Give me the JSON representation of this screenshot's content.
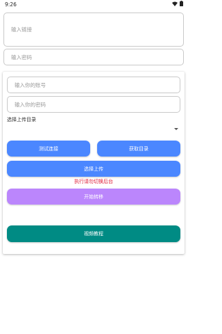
{
  "status_bar": {
    "time": "9:26"
  },
  "link_input": {
    "placeholder": "输入链接"
  },
  "password_input": {
    "placeholder": "输入密码"
  },
  "panel": {
    "account_input": {
      "placeholder": "输入你的账号"
    },
    "account_password_input": {
      "placeholder": "输入你的密码"
    },
    "upload_dir_label": "选择上传目录",
    "upload_dir_value": "",
    "test_connection_label": "测试连接",
    "get_directory_label": "获取目录",
    "select_upload_label": "选择上传",
    "warning_text": "执行请勿切换后台",
    "start_transfer_label": "开始转移",
    "video_tutorial_label": "视频教程"
  },
  "colors": {
    "blue": "#4b87ff",
    "purple": "#bb86fc",
    "teal": "#008b84",
    "warning": "#e0203a"
  }
}
